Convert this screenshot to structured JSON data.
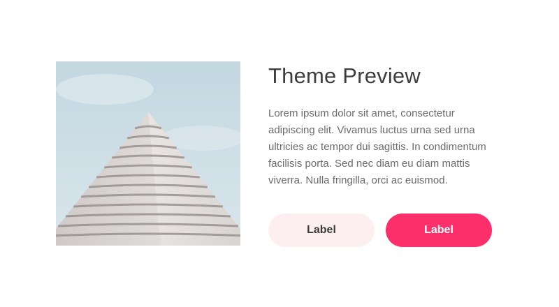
{
  "card": {
    "image_alt": "building-photo",
    "title": "Theme Preview",
    "description": "Lorem ipsum dolor sit amet, consectetur adipiscing elit. Vivamus luctus urna sed urna ultricies ac tempor dui sagittis. In condimentum facilisis porta. Sed nec diam eu diam mattis viverra. Nulla fringilla, orci ac euismod.",
    "secondary_button_label": "Label",
    "primary_button_label": "Label"
  },
  "colors": {
    "primary": "#fc2f6a",
    "secondary_bg": "#fdeff0",
    "title": "#3d3d3d",
    "body": "#6b6b6b"
  }
}
